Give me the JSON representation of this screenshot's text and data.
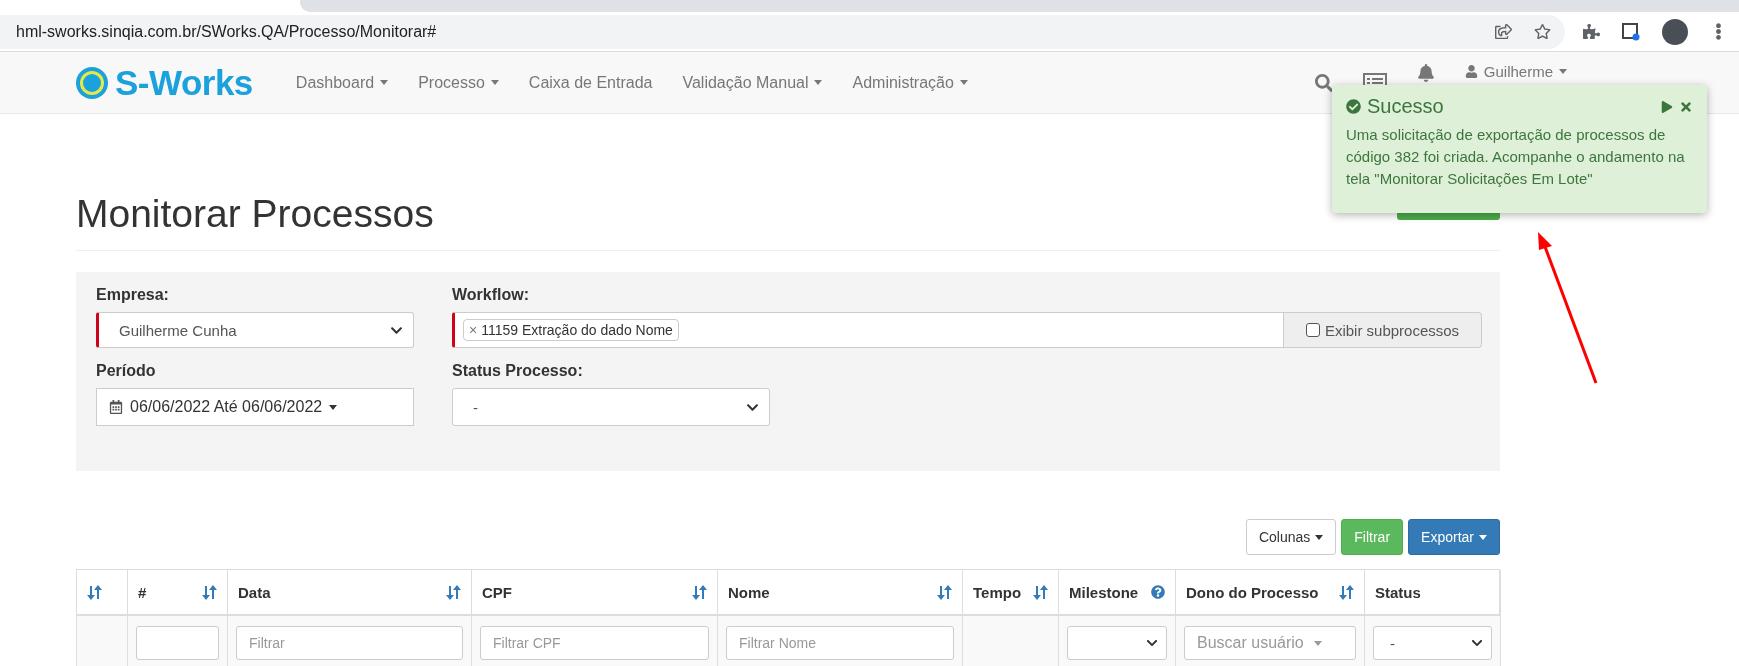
{
  "browser": {
    "url": "hml-sworks.sinqia.com.br/SWorks.QA/Processo/Monitorar#"
  },
  "navbar": {
    "brand": "S-Works",
    "menu": [
      {
        "label": "Dashboard",
        "dropdown": true
      },
      {
        "label": "Processo",
        "dropdown": true
      },
      {
        "label": "Caixa de Entrada",
        "dropdown": false
      },
      {
        "label": "Validação Manual",
        "dropdown": true
      },
      {
        "label": "Administração",
        "dropdown": true
      }
    ],
    "user": "Guilherme"
  },
  "toast": {
    "title": "Sucesso",
    "message": "Uma solicitação de exportação de processos de código 382 foi criada. Acompanhe o andamento na tela \"Monitorar Solicitações Em Lote\""
  },
  "page_title": "Monitorar Processos",
  "filters": {
    "empresa": {
      "label": "Empresa:",
      "value": "Guilherme Cunha",
      "required": true
    },
    "workflow": {
      "label": "Workflow:",
      "tags": [
        {
          "remove": "×",
          "label": "11159 Extração do dado Nome"
        }
      ],
      "required": true,
      "subprocess": {
        "label": "Exibir subprocessos",
        "checked": false
      }
    },
    "periodo": {
      "label": "Período",
      "value": "06/06/2022 Até 06/06/2022"
    },
    "status": {
      "label": "Status Processo:",
      "value": "-"
    }
  },
  "toolbar": [
    {
      "label": "Colunas",
      "kind": "default",
      "dropdown": true
    },
    {
      "label": "Filtrar",
      "kind": "success",
      "dropdown": false
    },
    {
      "label": "Exportar",
      "kind": "primary",
      "dropdown": true
    }
  ],
  "table": {
    "columns": [
      {
        "sortable": true,
        "help": false,
        "filter": {
          "kind": "none"
        }
      },
      {
        "label": "#",
        "sortable": true,
        "help": false,
        "filter": {
          "kind": "input"
        }
      },
      {
        "label": "Data",
        "sortable": true,
        "help": false,
        "filter": {
          "kind": "input",
          "placeholder": "Filtrar"
        }
      },
      {
        "label": "CPF",
        "sortable": true,
        "help": false,
        "filter": {
          "kind": "input",
          "placeholder": "Filtrar CPF"
        }
      },
      {
        "label": "Nome",
        "sortable": true,
        "help": false,
        "filter": {
          "kind": "input",
          "placeholder": "Filtrar Nome"
        }
      },
      {
        "label": "Tempo",
        "sortable": true,
        "help": false,
        "filter": {
          "kind": "none"
        }
      },
      {
        "label": "Milestone",
        "sortable": false,
        "help": true,
        "filter": {
          "kind": "select"
        }
      },
      {
        "label": "Dono do Processo",
        "sortable": true,
        "help": false,
        "filter": {
          "kind": "user-select",
          "placeholder": "Buscar usuário"
        }
      },
      {
        "label": "Status",
        "sortable": false,
        "help": false,
        "filter": {
          "kind": "select",
          "value": "-"
        }
      }
    ]
  }
}
